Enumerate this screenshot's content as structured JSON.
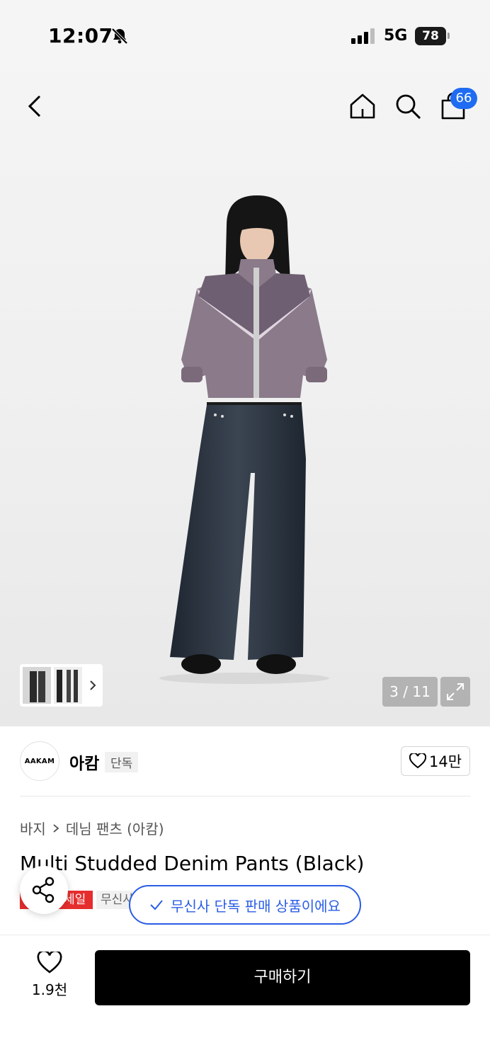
{
  "status_bar": {
    "time": "12:07",
    "network": "5G",
    "battery": "78"
  },
  "header": {
    "cart_count": "66"
  },
  "gallery": {
    "counter": "3 / 11"
  },
  "brand": {
    "logo_text": "AAKAM",
    "name": "아캄",
    "tag": "단독",
    "likes": "14만"
  },
  "product": {
    "breadcrumb": [
      "바지",
      "데님 팬츠 (아캄)"
    ],
    "title": "Multi Studded Denim Pants (Black)",
    "sale_tag": "세일",
    "grey_tag": "무신사",
    "exclusive_notice": "무신사 단독 판매 상품이에요"
  },
  "bottom_bar": {
    "wish_count": "1.9천",
    "buy_label": "구매하기"
  },
  "colors": {
    "accent_blue": "#2a5de6",
    "badge_blue": "#1f6cf2",
    "sale_red": "#e62d2d",
    "button_black": "#000000"
  }
}
